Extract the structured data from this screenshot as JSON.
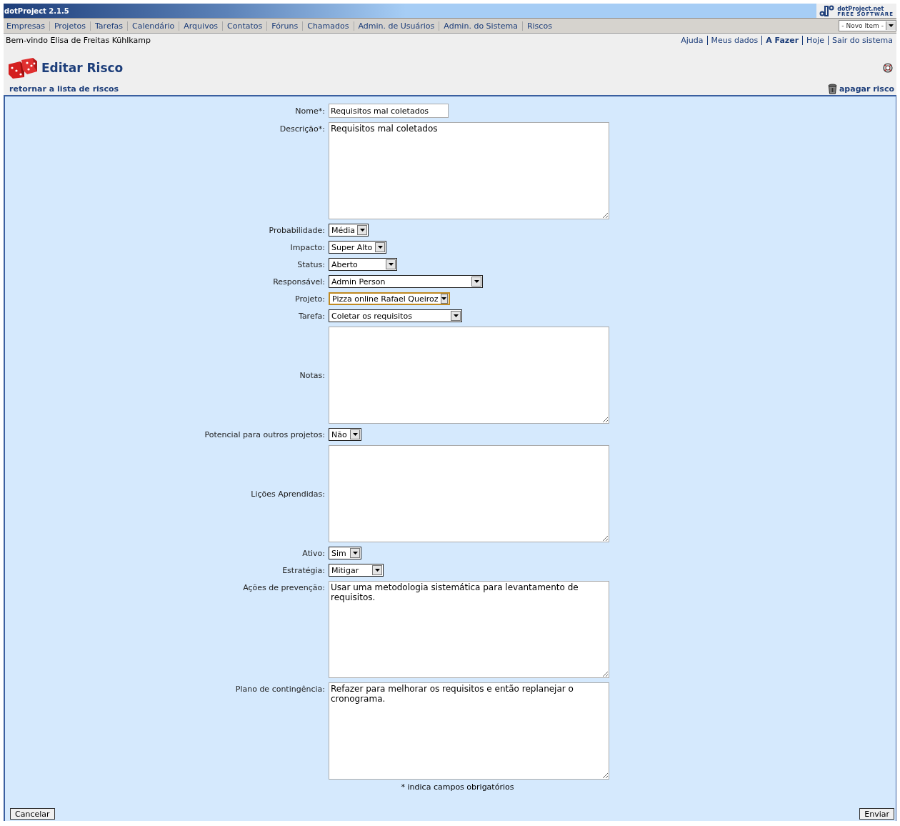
{
  "app": {
    "title": "dotProject 2.1.5",
    "logo_name": "dotProject.net",
    "logo_tagline": "FREE SOFTWARE"
  },
  "nav": [
    "Empresas",
    "Projetos",
    "Tarefas",
    "Calendário",
    "Arquivos",
    "Contatos",
    "Fóruns",
    "Chamados",
    "Admin. de Usuários",
    "Admin. do Sistema",
    "Riscos"
  ],
  "new_item": "- Novo Item -",
  "welcome": "Bem-vindo Elisa de Freitas Kühlkamp",
  "user_links": [
    {
      "label": "Ajuda",
      "emphasis": false
    },
    {
      "label": "Meus dados",
      "emphasis": false
    },
    {
      "label": "A Fazer",
      "emphasis": true
    },
    {
      "label": "Hoje",
      "emphasis": false
    },
    {
      "label": "Sair do sistema",
      "emphasis": false
    }
  ],
  "page_title": "Editar Risco",
  "back_link": "retornar a lista de riscos",
  "delete_link": "apagar risco",
  "fields": [
    {
      "label": "Nome*:",
      "kind": "text",
      "value": "Requisitos mal coletados"
    },
    {
      "label": "Descrição*:",
      "kind": "textarea",
      "value": "Requisitos mal coletados"
    },
    {
      "label": "Probabilidade:",
      "kind": "select",
      "value": "Média",
      "focused": false
    },
    {
      "label": "Impacto:",
      "kind": "select",
      "value": "Super Alto",
      "focused": false
    },
    {
      "label": "Status:",
      "kind": "select",
      "value": "Aberto",
      "focused": false
    },
    {
      "label": "Responsável:",
      "kind": "select",
      "value": "Admin Person",
      "focused": false
    },
    {
      "label": "Projeto:",
      "kind": "select",
      "value": "Pizza online Rafael Queiroz",
      "focused": true
    },
    {
      "label": "Tarefa:",
      "kind": "select",
      "value": "Coletar os requisitos",
      "focused": false
    },
    {
      "label": "Notas:",
      "kind": "textarea"
    },
    {
      "label": "Potencial para outros projetos:",
      "kind": "select",
      "value": "Não",
      "focused": false
    },
    {
      "label": "Lições Aprendidas:",
      "kind": "textarea"
    },
    {
      "label": "Ativo:",
      "kind": "select",
      "value": "Sim",
      "focused": false
    },
    {
      "label": "Estratégia:",
      "kind": "select",
      "value": "Mitigar",
      "focused": false
    },
    {
      "label": "Ações de prevenção:",
      "kind": "textarea",
      "value": "Usar uma metodologia sistemática para levantamento de requisitos."
    },
    {
      "label": "Plano de contingência:",
      "kind": "textarea",
      "value": "Refazer para melhorar os requisitos e então replanejar o cronograma."
    }
  ],
  "required_note": "* indica campos obrigatórios",
  "cancel_button": "Cancelar",
  "submit_button": "Enviar"
}
